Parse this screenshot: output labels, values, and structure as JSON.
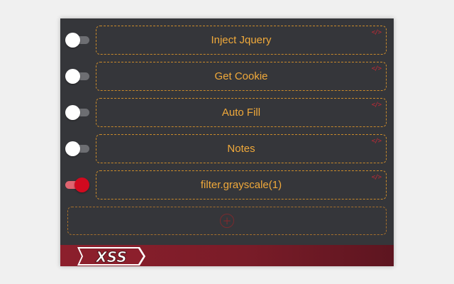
{
  "scripts": [
    {
      "label": "Inject Jquery",
      "enabled": false,
      "icon": "code-icon"
    },
    {
      "label": "Get Cookie",
      "enabled": false,
      "icon": "code-icon"
    },
    {
      "label": "Auto Fill",
      "enabled": false,
      "icon": "code-icon"
    },
    {
      "label": "Notes",
      "enabled": false,
      "icon": "code-icon"
    },
    {
      "label": "filter.grayscale(1)",
      "enabled": true,
      "icon": "code-icon"
    }
  ],
  "code_icon_text": "</>",
  "add_button": {
    "icon": "plus-circle-icon",
    "symbol": "+"
  },
  "footer": {
    "logo_text": "XSS"
  },
  "colors": {
    "panel_bg": "#35363a",
    "label_orange": "#f0a93a",
    "dashed_border": "#c98a2b",
    "toggle_on": "#d10a1f",
    "footer_red": "#8c1f2c"
  }
}
